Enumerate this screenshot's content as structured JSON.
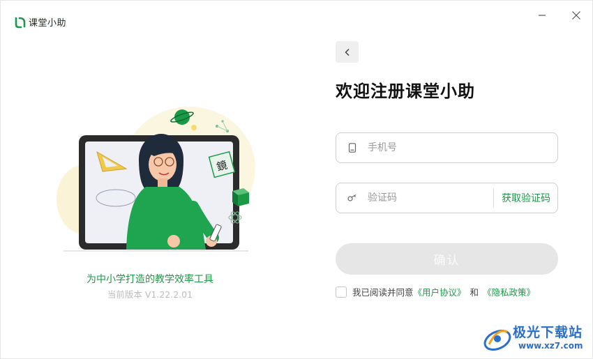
{
  "app": {
    "name": "课堂小助"
  },
  "left_panel": {
    "tagline": "为中小学打造的教学效率工具",
    "version": "当前版本 V1.22.2.01"
  },
  "form": {
    "title": "欢迎注册课堂小助",
    "phone_placeholder": "手机号",
    "code_placeholder": "验证码",
    "get_code_label": "获取验证码",
    "confirm_label": "确认",
    "agree_prefix": "我已阅读并同意",
    "user_agreement": "《用户协议》",
    "and_text": "和",
    "privacy_policy": "《隐私政策》"
  },
  "watermark": {
    "name": "极光下载站",
    "url": "www.xz7.com"
  },
  "colors": {
    "brand_green": "#1a9a46",
    "disabled_button": "#e6e6e6",
    "watermark_blue": "#2a6fc9"
  },
  "icons": {
    "back": "chevron-left-icon",
    "minimize": "minimize-icon",
    "close": "close-icon",
    "phone": "phone-icon",
    "key": "key-icon"
  }
}
